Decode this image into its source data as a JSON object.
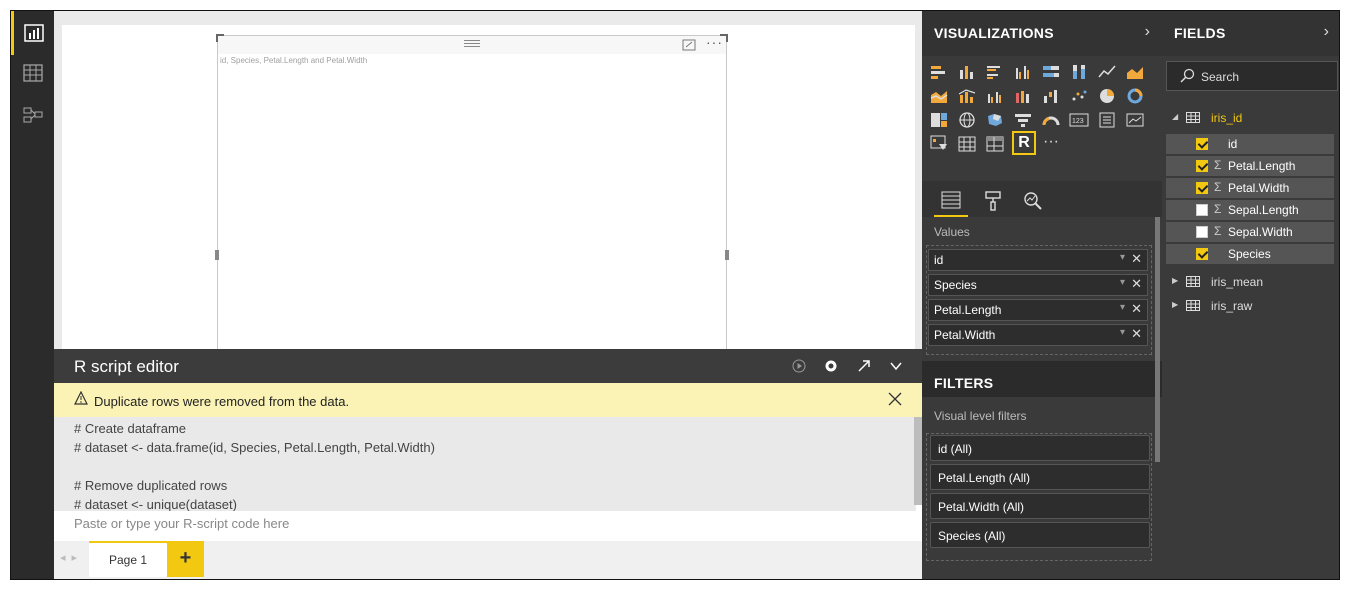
{
  "visual": {
    "title": "id, Species, Petal.Length and Petal.Width"
  },
  "r_editor": {
    "title": "R script editor",
    "warning": "Duplicate rows were removed from the data.",
    "code_lines": [
      "# Create dataframe",
      "# dataset <- data.frame(id, Species, Petal.Length, Petal.Width)",
      "",
      "# Remove duplicated rows",
      "# dataset <- unique(dataset)"
    ],
    "placeholder": "Paste or type your R-script code here"
  },
  "pages": {
    "tab": "Page 1",
    "add": "+"
  },
  "visualizations": {
    "title": "VISUALIZATIONS",
    "values_label": "Values",
    "values": [
      "id",
      "Species",
      "Petal.Length",
      "Petal.Width"
    ]
  },
  "filters": {
    "title": "FILTERS",
    "visual_level_label": "Visual level filters",
    "items": [
      "id (All)",
      "Petal.Length  (All)",
      "Petal.Width  (All)",
      "Species  (All)"
    ]
  },
  "fields": {
    "title": "FIELDS",
    "search_placeholder": "Search",
    "tables": [
      {
        "name": "iris_id",
        "expanded": true,
        "fields": [
          {
            "name": "id",
            "checked": true,
            "sigma": false
          },
          {
            "name": "Petal.Length",
            "checked": true,
            "sigma": true
          },
          {
            "name": "Petal.Width",
            "checked": true,
            "sigma": true
          },
          {
            "name": "Sepal.Length",
            "checked": false,
            "sigma": true
          },
          {
            "name": "Sepal.Width",
            "checked": false,
            "sigma": true
          },
          {
            "name": "Species",
            "checked": true,
            "sigma": false
          }
        ]
      },
      {
        "name": "iris_mean",
        "expanded": false
      },
      {
        "name": "iris_raw",
        "expanded": false
      }
    ]
  },
  "colors": {
    "accent": "#f2c811",
    "pane_bg": "#3a3a3a",
    "warning_bg": "#fbf3b5"
  }
}
